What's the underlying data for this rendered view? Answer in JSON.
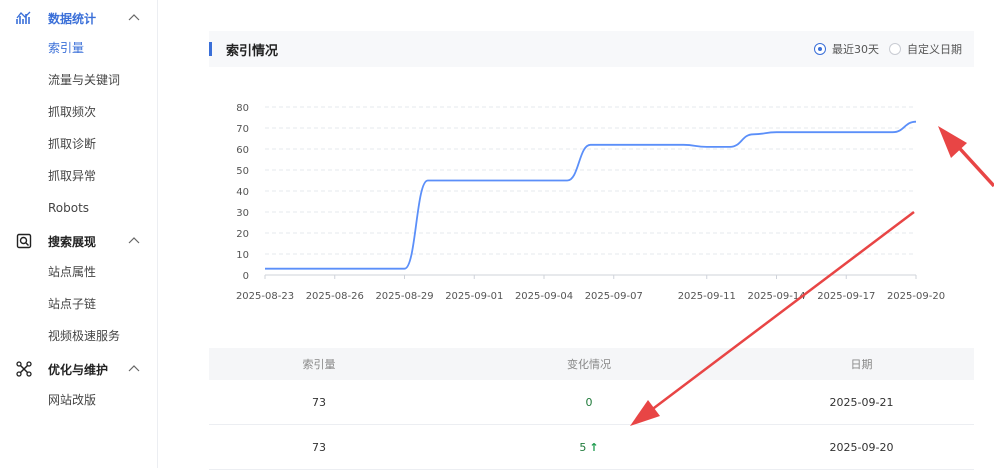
{
  "sidebar": {
    "sections": [
      {
        "icon": "bar-chart-icon",
        "label": "数据统计",
        "active": true,
        "items": [
          "索引量",
          "流量与关键词",
          "抓取频次",
          "抓取诊断",
          "抓取异常",
          "Robots"
        ]
      },
      {
        "icon": "search-document-icon",
        "label": "搜索展现",
        "active": false,
        "items": [
          "站点属性",
          "站点子链",
          "视频极速服务"
        ]
      },
      {
        "icon": "tools-icon",
        "label": "优化与维护",
        "active": false,
        "items": [
          "网站改版"
        ]
      }
    ]
  },
  "panel": {
    "title": "索引情况",
    "radio_recent": "最近30天",
    "radio_custom": "自定义日期"
  },
  "chart_data": {
    "type": "line",
    "x": [
      "2025-08-23",
      "2025-08-24",
      "2025-08-25",
      "2025-08-26",
      "2025-08-27",
      "2025-08-28",
      "2025-08-29",
      "2025-08-30",
      "2025-08-31",
      "2025-09-01",
      "2025-09-02",
      "2025-09-03",
      "2025-09-04",
      "2025-09-05",
      "2025-09-06",
      "2025-09-07",
      "2025-09-08",
      "2025-09-09",
      "2025-09-10",
      "2025-09-11",
      "2025-09-12",
      "2025-09-13",
      "2025-09-14",
      "2025-09-15",
      "2025-09-16",
      "2025-09-17",
      "2025-09-18",
      "2025-09-19",
      "2025-09-20"
    ],
    "xticks": [
      "2025-08-23",
      "2025-08-26",
      "2025-08-29",
      "2025-09-01",
      "2025-09-04",
      "2025-09-07",
      "2025-09-11",
      "2025-09-14",
      "2025-09-17",
      "2025-09-20"
    ],
    "series": [
      {
        "values": [
          3,
          3,
          3,
          3,
          3,
          3,
          3,
          45,
          45,
          45,
          45,
          45,
          45,
          45,
          62,
          62,
          62,
          62,
          62,
          61,
          61,
          67,
          68,
          68,
          68,
          68,
          68,
          68,
          73,
          73
        ],
        "color": "#5b8ff9"
      }
    ],
    "ylim": [
      0,
      80
    ],
    "yticks": [
      0,
      10,
      20,
      30,
      40,
      50,
      60,
      70,
      80
    ],
    "grid": true
  },
  "table": {
    "headers": [
      "索引量",
      "变化情况",
      "日期"
    ],
    "rows": [
      {
        "count": "73",
        "change": "0",
        "up": false,
        "date": "2025-09-21"
      },
      {
        "count": "73",
        "change": "5",
        "up": true,
        "date": "2025-09-20"
      }
    ]
  },
  "annotation_color": "#e84545"
}
